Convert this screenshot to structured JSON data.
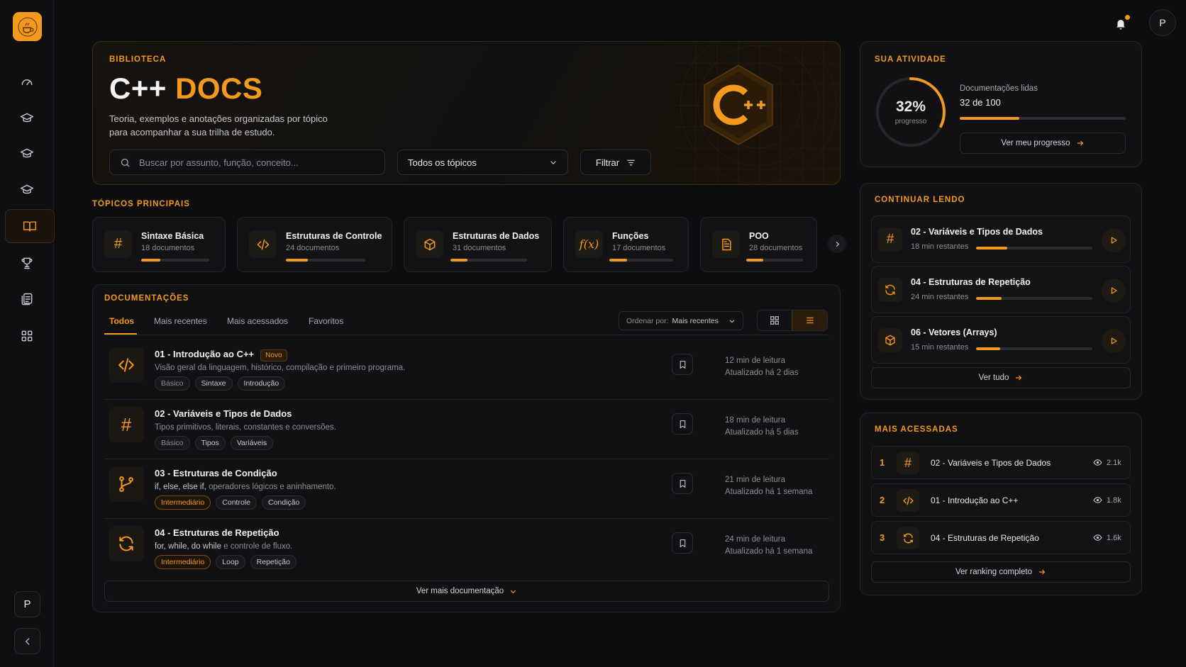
{
  "sidebar": {
    "logo_alt": "Café do Programador",
    "avatar": "P",
    "nav": [
      "dashboard",
      "courses",
      "courses-2",
      "courses-3",
      "docs",
      "trophy",
      "library",
      "apps"
    ]
  },
  "header": {
    "avatar": "P"
  },
  "hero": {
    "label": "BIBLIOTECA",
    "title_part1": "C++",
    "title_part2": "DOCS",
    "subtitle_line1": "Teoria, exemplos e anotações organizadas por tópico",
    "subtitle_line2": "para acompanhar a sua trilha de estudo.",
    "search_placeholder": "Buscar por assunto, função, conceito...",
    "topic_select": "Todos os tópicos",
    "filter_label": "Filtrar",
    "logo_text": "C++"
  },
  "topics": {
    "label": "TÓPICOS PRINCIPAIS",
    "items": [
      {
        "icon": "hash-icon",
        "title": "Sintaxe Básica",
        "count": "18 documentos",
        "progress": 0.28
      },
      {
        "icon": "code-icon",
        "title": "Estruturas de Controle",
        "count": "24 documentos",
        "progress": 0.28
      },
      {
        "icon": "cube-icon",
        "title": "Estruturas de Dados",
        "count": "31 documentos",
        "progress": 0.22
      },
      {
        "icon": "function-icon",
        "title": "Funções",
        "count": "17 documentos",
        "progress": 0.28
      },
      {
        "icon": "document-icon",
        "title": "POO",
        "count": "28 documentos",
        "progress": 0.3
      }
    ]
  },
  "docs": {
    "label": "DOCUMENTAÇÕES",
    "tabs": [
      "Todos",
      "Mais recentes",
      "Mais acessados",
      "Favoritos"
    ],
    "active_tab": "Todos",
    "sort_prefix": "Ordenar por:",
    "sort_value": "Mais recentes",
    "items": [
      {
        "icon": "code-icon",
        "title": "01 - Introdução ao C++",
        "badge": "Novo",
        "desc": "Visão geral da linguagem, histórico, compilação e primeiro programa.",
        "tags": [
          "Básico",
          "Sintaxe",
          "Introdução"
        ],
        "read": "12 min de leitura",
        "updated": "Atualizado há 2 dias"
      },
      {
        "icon": "hash-icon",
        "title": "02 - Variáveis e Tipos de Dados",
        "badge": "",
        "desc": "Tipos primitivos, literais, constantes e conversões.",
        "tags": [
          "Básico",
          "Tipos",
          "Variáveis"
        ],
        "read": "18 min de leitura",
        "updated": "Atualizado há 5 dias"
      },
      {
        "icon": "branch-icon",
        "title": "03 - Estruturas de Condição",
        "badge": "",
        "desc_code": "if, else, else if,",
        "desc": " operadores lógicos e aninhamento.",
        "tags": [
          "Intermediário",
          "Controle",
          "Condição"
        ],
        "read": "21 min de leitura",
        "updated": "Atualizado há 1 semana"
      },
      {
        "icon": "repeat-icon",
        "title": "04 - Estruturas de Repetição",
        "badge": "",
        "desc_code": "for, while, do while",
        "desc": " e controle de fluxo.",
        "tags": [
          "Intermediário",
          "Loop",
          "Repetição"
        ],
        "read": "24 min de leitura",
        "updated": "Atualizado há 1 semana"
      }
    ],
    "more_label": "Ver mais documentação"
  },
  "activity": {
    "label": "SUA ATIVIDADE",
    "percent": "32%",
    "percent_label": "progresso",
    "progress": 0.32,
    "read_label": "Documentações lidas",
    "read_value": "32 de 100",
    "button": "Ver meu progresso"
  },
  "continue": {
    "label": "CONTINUAR LENDO",
    "items": [
      {
        "icon": "hash-icon",
        "title": "02 - Variáveis e Tipos de Dados",
        "remaining": "18 min restantes",
        "progress": 0.27
      },
      {
        "icon": "repeat-icon",
        "title": "04 - Estruturas de Repetição",
        "remaining": "24 min restantes",
        "progress": 0.22
      },
      {
        "icon": "cube-icon",
        "title": "06 - Vetores (Arrays)",
        "remaining": "15 min restantes",
        "progress": 0.21
      }
    ],
    "button": "Ver tudo"
  },
  "popular": {
    "label": "MAIS ACESSADAS",
    "items": [
      {
        "rank": "1",
        "icon": "hash-icon",
        "title": "02 - Variáveis e Tipos de Dados",
        "views": "2.1k"
      },
      {
        "rank": "2",
        "icon": "code-icon",
        "title": "01 - Introdução ao C++",
        "views": "1.8k"
      },
      {
        "rank": "3",
        "icon": "repeat-icon",
        "title": "04 - Estruturas de Repetição",
        "views": "1.6k"
      }
    ],
    "button": "Ver ranking completo"
  },
  "colors": {
    "accent": "#f39a1e",
    "bg": "#0d0d10",
    "card": "#111114"
  }
}
